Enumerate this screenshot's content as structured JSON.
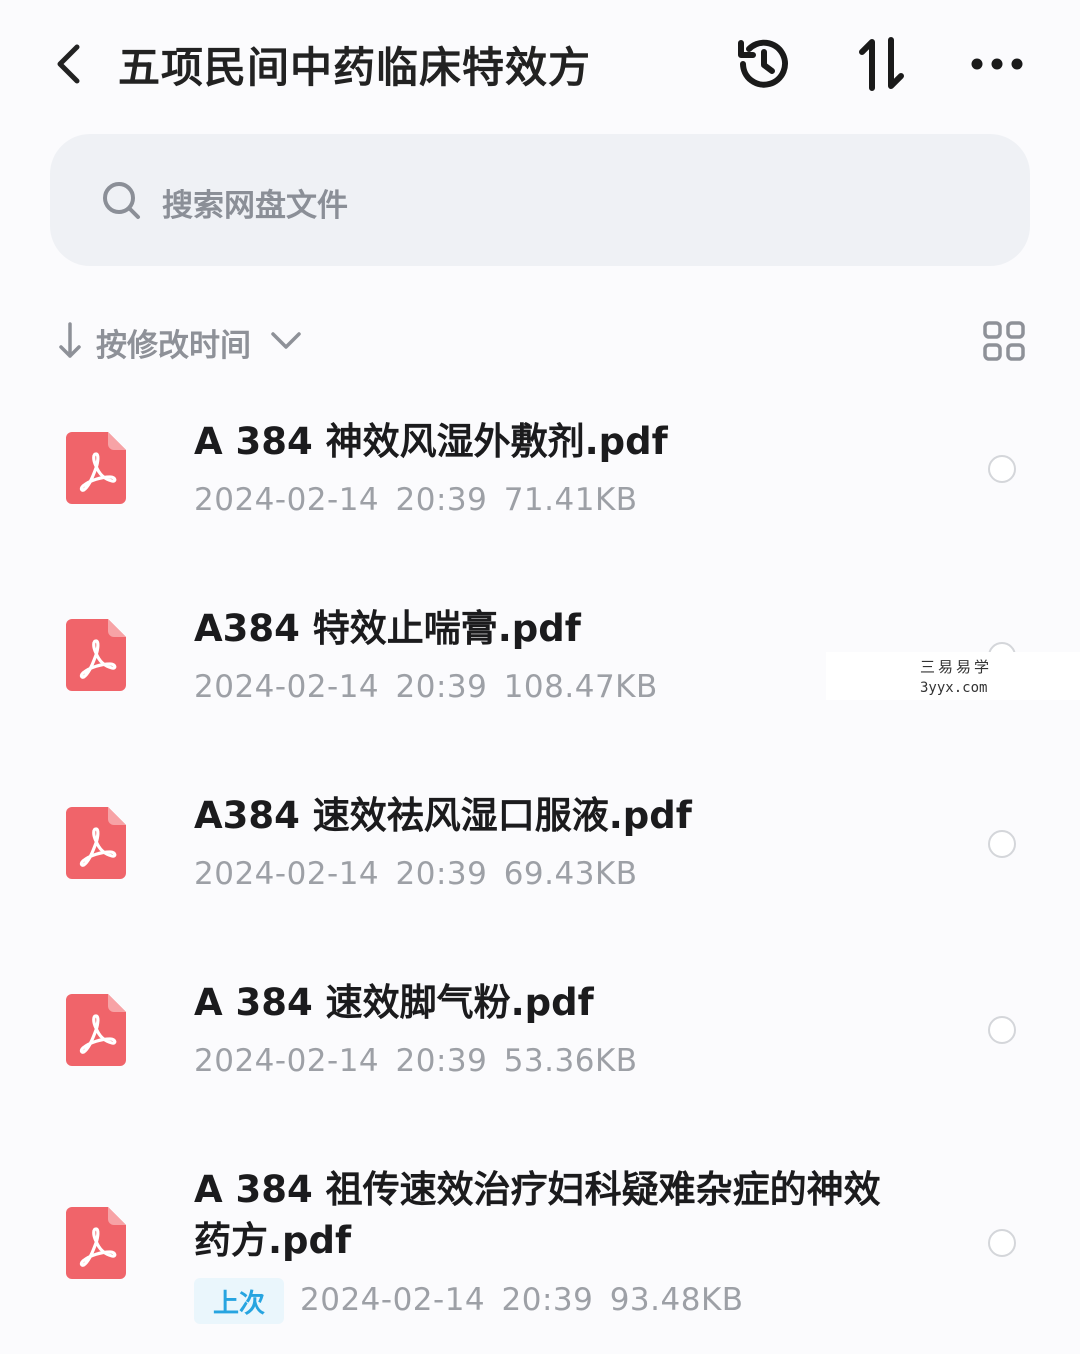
{
  "header": {
    "title": "五项民间中药临床特效方",
    "back_icon": "chevron-left-icon",
    "history_icon": "history-icon",
    "transfer_icon": "transfer-arrows-icon",
    "more_icon": "more-horizontal-icon"
  },
  "search": {
    "placeholder": "搜索网盘文件",
    "icon": "search-icon"
  },
  "sort": {
    "label": "按修改时间",
    "direction_icon": "arrow-down-icon",
    "dropdown_icon": "chevron-down-icon",
    "view_icon": "grid-view-icon"
  },
  "files": [
    {
      "name": "A 384 神效风湿外敷剂.pdf",
      "meta": "2024-02-14  20:39  71.41KB"
    },
    {
      "name": "A384  特效止喘膏.pdf",
      "meta": "2024-02-14  20:39  108.47KB"
    },
    {
      "name": "A384  速效祛风湿口服液.pdf",
      "meta": "2024-02-14  20:39  69.43KB"
    },
    {
      "name": "A 384 速效脚气粉.pdf",
      "meta": "2024-02-14  20:39  53.36KB"
    },
    {
      "name_line1": "A 384 祖传速效治疗妇科疑难杂症的神效",
      "name_line2": "药方.pdf",
      "badge": "上次",
      "meta": "2024-02-14  20:39  93.48KB"
    }
  ],
  "watermark": {
    "line1": "三易易学",
    "line2": "3yyx.com"
  },
  "colors": {
    "pdf_icon": "#f0646a",
    "badge_text": "#27a4e0",
    "search_bg": "#eff1f5"
  }
}
